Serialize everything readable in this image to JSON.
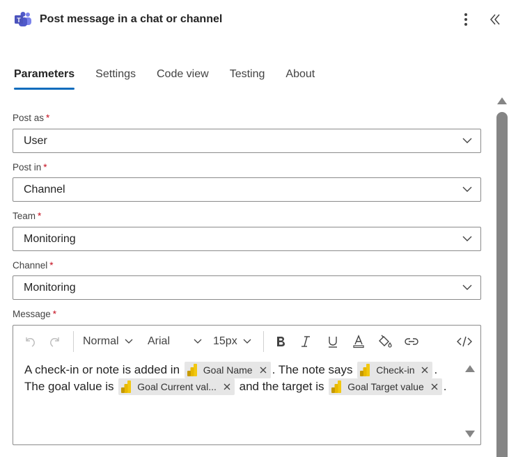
{
  "header": {
    "icon": "teams-icon",
    "title": "Post message in a chat or channel",
    "more_icon": "more-vertical-icon",
    "collapse_icon": "double-chevron-left-icon"
  },
  "tabs": [
    {
      "label": "Parameters",
      "active": true
    },
    {
      "label": "Settings",
      "active": false
    },
    {
      "label": "Code view",
      "active": false
    },
    {
      "label": "Testing",
      "active": false
    },
    {
      "label": "About",
      "active": false
    }
  ],
  "fields": {
    "post_as": {
      "label": "Post as",
      "required": "*",
      "value": "User"
    },
    "post_in": {
      "label": "Post in",
      "required": "*",
      "value": "Channel"
    },
    "team": {
      "label": "Team",
      "required": "*",
      "value": "Monitoring"
    },
    "channel": {
      "label": "Channel",
      "required": "*",
      "value": "Monitoring"
    },
    "message": {
      "label": "Message",
      "required": "*"
    }
  },
  "toolbar": {
    "undo_icon": "undo-icon",
    "redo_icon": "redo-icon",
    "paragraph_style": "Normal",
    "font_family": "Arial",
    "font_size": "15px",
    "bold_icon": "bold-icon",
    "italic_icon": "italic-icon",
    "underline_icon": "underline-icon",
    "font_color_icon": "font-color-icon",
    "highlight_icon": "paint-bucket-icon",
    "link_icon": "link-icon",
    "code_view_icon": "code-icon"
  },
  "message_body": {
    "text1": "A check-in or note is added in",
    "chip1": "Goal Name",
    "text2": ". The note says",
    "chip2": "Check-in",
    "text3": ".",
    "text4": "The goal value is",
    "chip3": "Goal Current val...",
    "text5": "and the target is",
    "chip4": "Goal Target value",
    "text6": "."
  },
  "colors": {
    "accent": "#0f6cbd",
    "required": "#c50f1f",
    "chip_bg": "#e6e6e6",
    "powerbi_yellow": "#f2c811"
  }
}
